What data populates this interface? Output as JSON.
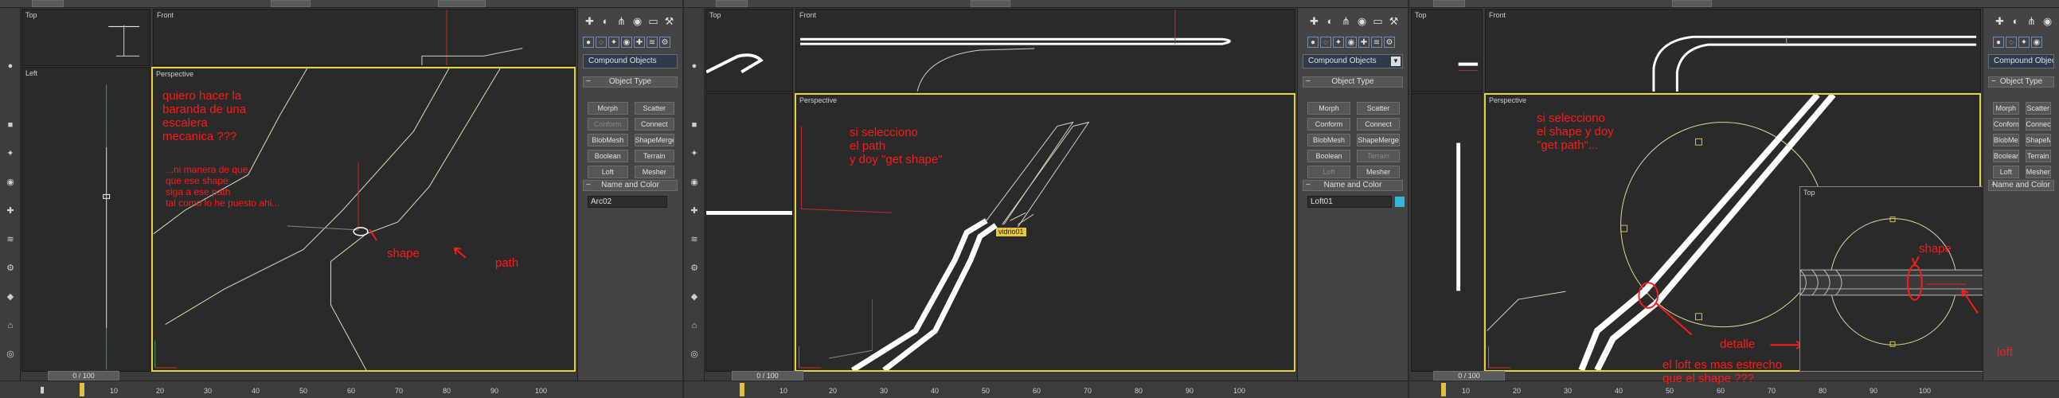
{
  "panels": [
    {
      "viewports": {
        "top": "Top",
        "front": "Front",
        "left": "Left",
        "perspective": "Perspective"
      },
      "command_panel": {
        "dropdown": "Compound Objects",
        "rollout_object_type": "Object Type",
        "buttons": [
          {
            "label": "Morph",
            "disabled": false
          },
          {
            "label": "Scatter",
            "disabled": false
          },
          {
            "label": "Conform",
            "disabled": true
          },
          {
            "label": "Connect",
            "disabled": false
          },
          {
            "label": "BlobMesh",
            "disabled": false
          },
          {
            "label": "ShapeMerge",
            "disabled": false
          },
          {
            "label": "Boolean",
            "disabled": false
          },
          {
            "label": "Terrain",
            "disabled": false
          },
          {
            "label": "Loft",
            "disabled": false
          },
          {
            "label": "Mesher",
            "disabled": false
          }
        ],
        "rollout_name_color": "Name and Color",
        "object_name": "Arc02"
      },
      "frame_counter": "0 / 100",
      "ticks": [
        "10",
        "20",
        "30",
        "40",
        "50",
        "60",
        "70",
        "80",
        "90",
        "100"
      ],
      "annotations": {
        "question": [
          "quiero hacer la",
          "baranda de una",
          " escalera",
          "mecanica ???"
        ],
        "detail": [
          "...ni manera de que",
          "que ese shape",
          "siga a ese path",
          "tal como lo he puesto ahi..."
        ],
        "shape": "shape",
        "path": "path"
      }
    },
    {
      "viewports": {
        "top": "Top",
        "front": "Front",
        "perspective": "Perspective"
      },
      "command_panel": {
        "dropdown": "Compound Objects",
        "rollout_object_type": "Object Type",
        "buttons": [
          {
            "label": "Morph",
            "disabled": false
          },
          {
            "label": "Scatter",
            "disabled": false
          },
          {
            "label": "Conform",
            "disabled": false
          },
          {
            "label": "Connect",
            "disabled": false
          },
          {
            "label": "BlobMesh",
            "disabled": false
          },
          {
            "label": "ShapeMerge",
            "disabled": false
          },
          {
            "label": "Boolean",
            "disabled": false
          },
          {
            "label": "Terrain",
            "disabled": true
          },
          {
            "label": "Loft",
            "disabled": true
          },
          {
            "label": "Mesher",
            "disabled": false
          }
        ],
        "rollout_name_color": "Name and Color",
        "object_name": "Loft01"
      },
      "frame_counter": "0 / 100",
      "ticks": [
        "10",
        "20",
        "30",
        "40",
        "50",
        "60",
        "70",
        "80",
        "90",
        "100"
      ],
      "object_tag": "vidrio01",
      "annotations": {
        "text": [
          "si selecciono",
          "el path",
          "y doy \"get shape\""
        ]
      }
    },
    {
      "viewports": {
        "top": "Top",
        "front": "Front",
        "perspective": "Perspective",
        "inset": "Top"
      },
      "command_panel": {
        "dropdown": "Compound Objects",
        "rollout_object_type": "Object Type",
        "buttons": [
          {
            "label": "Morph",
            "disabled": false
          },
          {
            "label": "Scatter",
            "disabled": false
          },
          {
            "label": "Conform",
            "disabled": false
          },
          {
            "label": "Connect",
            "disabled": false
          },
          {
            "label": "BlobMesh",
            "disabled": false
          },
          {
            "label": "ShapeMerge",
            "disabled": false
          },
          {
            "label": "Boolean",
            "disabled": false
          },
          {
            "label": "Terrain",
            "disabled": false
          },
          {
            "label": "Loft",
            "disabled": false
          },
          {
            "label": "Mesher",
            "disabled": false
          }
        ],
        "rollout_name_color": "Name and Color"
      },
      "frame_counter": "0 / 100",
      "ticks": [
        "10",
        "20",
        "30",
        "40",
        "50",
        "60",
        "70",
        "80",
        "90",
        "100"
      ],
      "annotations": {
        "text": [
          "si selecciono",
          "el shape y doy",
          "\"get path\"..."
        ],
        "detalle": "detalle",
        "loft_note": [
          "el loft es mas estrecho",
          "que el shape ???"
        ],
        "shape": "shape",
        "loft": "loft"
      }
    }
  ],
  "colors": {
    "accent_active_viewport": "#e6d23a",
    "annotation_red": "#ff1a1a",
    "object_color_swatch": "#36b8d6"
  }
}
